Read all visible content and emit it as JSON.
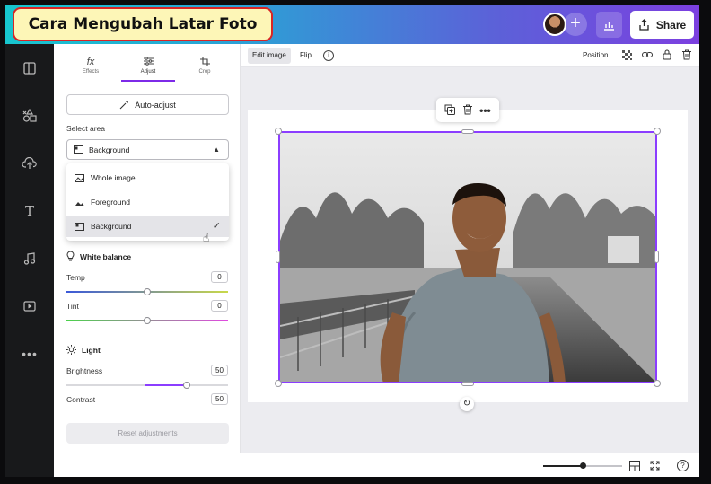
{
  "banner": {
    "title": "Cara Mengubah Latar Foto"
  },
  "topbar": {
    "share_label": "Share",
    "add_label": "+"
  },
  "panel": {
    "tabs": [
      {
        "label": "Effects",
        "icon": "fx-icon"
      },
      {
        "label": "Adjust",
        "icon": "sliders-icon",
        "active": true
      },
      {
        "label": "Crop",
        "icon": "crop-icon"
      }
    ],
    "auto_adjust_label": "Auto-adjust",
    "select_area_label": "Select area",
    "select_value": "Background",
    "dropdown_items": [
      {
        "label": "Whole image",
        "icon": "whole-image-icon"
      },
      {
        "label": "Foreground",
        "icon": "foreground-icon"
      },
      {
        "label": "Background",
        "icon": "background-icon",
        "selected": true
      }
    ],
    "white_balance": {
      "title": "White balance",
      "temp_label": "Temp",
      "temp_value": "0",
      "tint_label": "Tint",
      "tint_value": "0"
    },
    "light": {
      "title": "Light",
      "brightness_label": "Brightness",
      "brightness_value": "50",
      "contrast_label": "Contrast",
      "contrast_value": "50"
    },
    "reset_label": "Reset adjustments"
  },
  "context_bar": {
    "edit_image_label": "Edit image",
    "flip_label": "Flip",
    "info_label": "i",
    "position_label": "Position"
  },
  "colors": {
    "accent": "#8b3dff",
    "topbar_start": "#17c6cf",
    "topbar_end": "#7c3fe0",
    "banner_bg": "#fdf6b7",
    "banner_border": "#d92525"
  }
}
